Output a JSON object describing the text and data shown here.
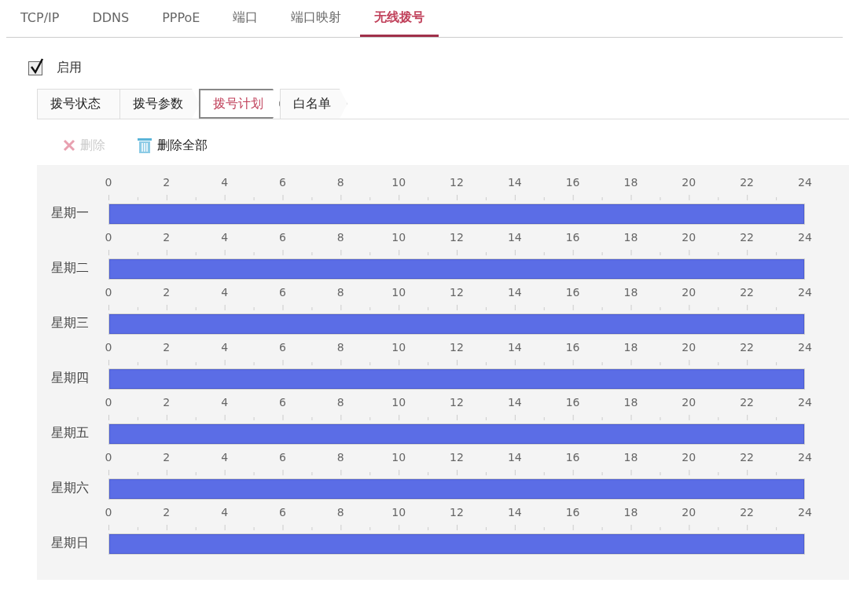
{
  "tabs": [
    {
      "label": "TCP/IP",
      "selected": false
    },
    {
      "label": "DDNS",
      "selected": false
    },
    {
      "label": "PPPoE",
      "selected": false
    },
    {
      "label": "端口",
      "selected": false
    },
    {
      "label": "端口映射",
      "selected": false
    },
    {
      "label": "无线拨号",
      "selected": true
    }
  ],
  "enable": {
    "label": "启用",
    "checked": true
  },
  "steps": [
    {
      "label": "拨号状态",
      "selected": false
    },
    {
      "label": "拨号参数",
      "selected": false
    },
    {
      "label": "拨号计划",
      "selected": true
    },
    {
      "label": "白名单",
      "selected": false
    }
  ],
  "toolbar": [
    {
      "kind": "delete",
      "label": "删除",
      "disabled": true
    },
    {
      "kind": "delete_all",
      "label": "删除全部",
      "disabled": false
    }
  ],
  "schedule": [
    {
      "day": "星期一",
      "ticks": [
        "0",
        "2",
        "4",
        "6",
        "8",
        "10",
        "12",
        "14",
        "16",
        "18",
        "20",
        "22",
        "24"
      ],
      "level": 1
    },
    {
      "day": "星期二",
      "ticks": [
        "0",
        "2",
        "4",
        "6",
        "8",
        "10",
        "12",
        "14",
        "16",
        "18",
        "20",
        "22",
        "24"
      ],
      "level": 1
    },
    {
      "day": "星期三",
      "ticks": [
        "0",
        "2",
        "4",
        "6",
        "8",
        "10",
        "12",
        "14",
        "16",
        "18",
        "20",
        "22",
        "24"
      ],
      "level": 1
    },
    {
      "day": "星期四",
      "ticks": [
        "0",
        "2",
        "4",
        "6",
        "8",
        "10",
        "12",
        "14",
        "16",
        "18",
        "20",
        "22",
        "24"
      ],
      "level": 1
    },
    {
      "day": "星期五",
      "ticks": [
        "0",
        "2",
        "4",
        "6",
        "8",
        "10",
        "12",
        "14",
        "16",
        "18",
        "20",
        "22",
        "24"
      ],
      "level": 1
    },
    {
      "day": "星期六",
      "ticks": [
        "0",
        "2",
        "4",
        "6",
        "8",
        "10",
        "12",
        "14",
        "16",
        "18",
        "20",
        "22",
        "24"
      ],
      "level": 1
    },
    {
      "day": "星期日",
      "ticks": [
        "0",
        "2",
        "4",
        "6",
        "8",
        "10",
        "12",
        "14",
        "16",
        "18",
        "20",
        "22",
        "24"
      ],
      "level": 1
    }
  ]
}
